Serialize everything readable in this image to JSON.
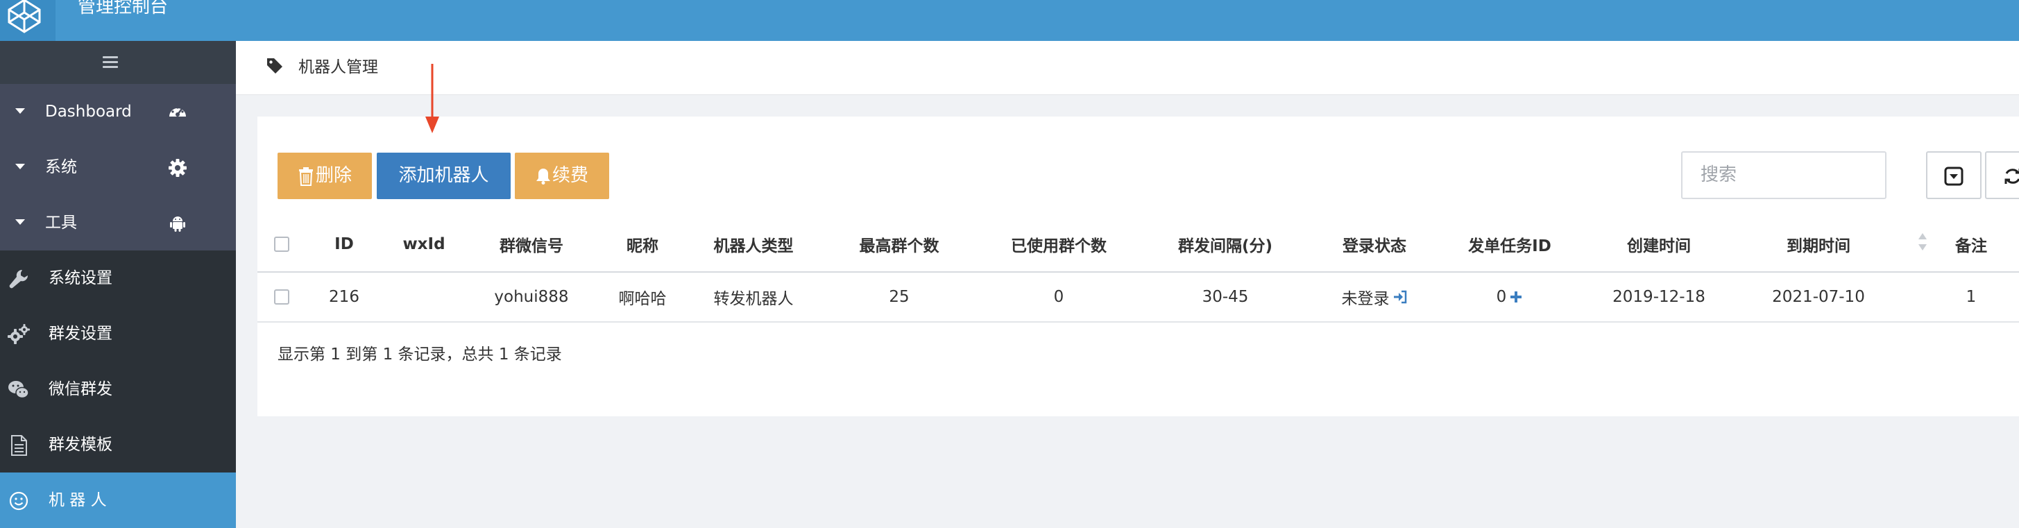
{
  "app": {
    "title": "管理控制台"
  },
  "sidebar": {
    "groups": [
      {
        "label": "Dashboard",
        "icon": "dashboard-icon"
      },
      {
        "label": "系统",
        "icon": "gear-icon"
      },
      {
        "label": "工具",
        "icon": "android-icon"
      }
    ],
    "items": [
      {
        "label": "系统设置",
        "icon": "wrench-icon"
      },
      {
        "label": "群发设置",
        "icon": "gears-icon"
      },
      {
        "label": "微信群发",
        "icon": "wechat-icon"
      },
      {
        "label": "群发模板",
        "icon": "document-icon"
      },
      {
        "label": "机 器 人",
        "icon": "smile-icon",
        "active": true
      }
    ]
  },
  "breadcrumb": {
    "label": "机器人管理"
  },
  "toolbar": {
    "delete_label": "删除",
    "add_label": "添加机器人",
    "renew_label": "续费",
    "search_placeholder": "搜索"
  },
  "table": {
    "columns": [
      "ID",
      "wxId",
      "群微信号",
      "昵称",
      "机器人类型",
      "最高群个数",
      "已使用群个数",
      "群发间隔(分)",
      "登录状态",
      "发单任务ID",
      "创建时间",
      "到期时间",
      "备注"
    ],
    "rows": [
      {
        "id": "216",
        "wxid": "",
        "wechat": "yohui888",
        "nickname": "啊哈哈",
        "type": "转发机器人",
        "max_groups": "25",
        "used_groups": "0",
        "interval": "30-45",
        "login_status": "未登录",
        "task_id": "0",
        "created": "2019-12-18",
        "expires": "2021-07-10",
        "remark": "1"
      }
    ]
  },
  "pagination": {
    "summary": "显示第 1 到第 1 条记录，总共 1 条记录"
  },
  "colors": {
    "topbar": "#4598cf",
    "sidebar": "#2b3137",
    "sidebar_group": "#444a5c",
    "active": "#4598cf",
    "btn_warning": "#e9ad58",
    "btn_primary": "#3b7ec0",
    "annotation_arrow": "#e8472a"
  }
}
